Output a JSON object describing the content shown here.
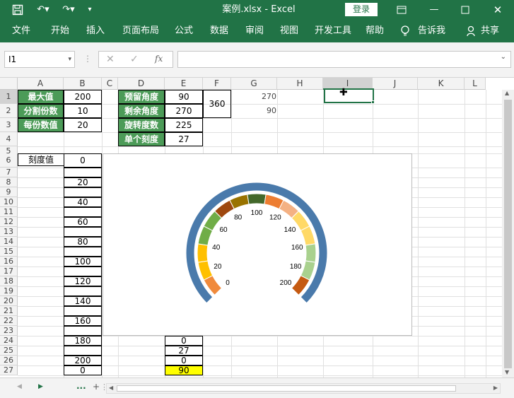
{
  "title": {
    "file": "案例.xlsx",
    "sep": "-",
    "app": "Excel",
    "login": "登录"
  },
  "ribbon": {
    "tabs": [
      "文件",
      "开始",
      "插入",
      "页面布局",
      "公式",
      "数据",
      "审阅",
      "视图",
      "开发工具",
      "帮助"
    ],
    "tellme": "告诉我",
    "share": "共享"
  },
  "formula": {
    "namebox": "I1",
    "fx": "fx",
    "value": ""
  },
  "columns": [
    "A",
    "B",
    "C",
    "D",
    "E",
    "F",
    "G",
    "H",
    "I",
    "J",
    "K",
    "L"
  ],
  "rows": [
    "1",
    "2",
    "3",
    "4",
    "5",
    "6",
    "7",
    "8",
    "9",
    "10",
    "11",
    "12",
    "13",
    "14",
    "15",
    "16",
    "17",
    "18",
    "19",
    "20",
    "21",
    "22",
    "23",
    "24",
    "25",
    "26",
    "27"
  ],
  "table1": {
    "labels": [
      "最大值",
      "分割份数",
      "每份数值"
    ],
    "values": [
      "200",
      "10",
      "20"
    ]
  },
  "table2": {
    "labels": [
      "预留角度",
      "剩余角度",
      "旋转度数",
      "单个刻度"
    ],
    "values": [
      "90",
      "270",
      "225",
      "27"
    ],
    "merged": "360"
  },
  "colG": [
    "270",
    "90"
  ],
  "scale": {
    "header": "刻度值",
    "values": [
      "0",
      "20",
      "40",
      "60",
      "80",
      "100",
      "120",
      "140",
      "160",
      "180",
      "200",
      "0"
    ]
  },
  "colE_bottom": [
    "0",
    "27",
    "0",
    "90"
  ],
  "chart_data": {
    "type": "pie",
    "subtype": "doughnut-gauge",
    "tick_labels": [
      "0",
      "20",
      "40",
      "60",
      "80",
      "100",
      "120",
      "140",
      "160",
      "180",
      "200"
    ],
    "outer_ring_color": "#4a7aab",
    "segment_colors": [
      "#f08a3c",
      "#ffc000",
      "#ffc000",
      "#70ad47",
      "#70ad47",
      "#9e480e",
      "#997300",
      "#43682b",
      "#ed7d31",
      "#f4b183",
      "#ffd966",
      "#ffd966",
      "#a9d18e",
      "#a9d18e",
      "#c55a11"
    ],
    "start_angle_deg": 225,
    "sweep_deg": 270,
    "min": 0,
    "max": 200
  },
  "colors": {
    "excel_green": "#217346",
    "label_green": "#4c9b58",
    "highlight_yellow": "#ffff00"
  }
}
